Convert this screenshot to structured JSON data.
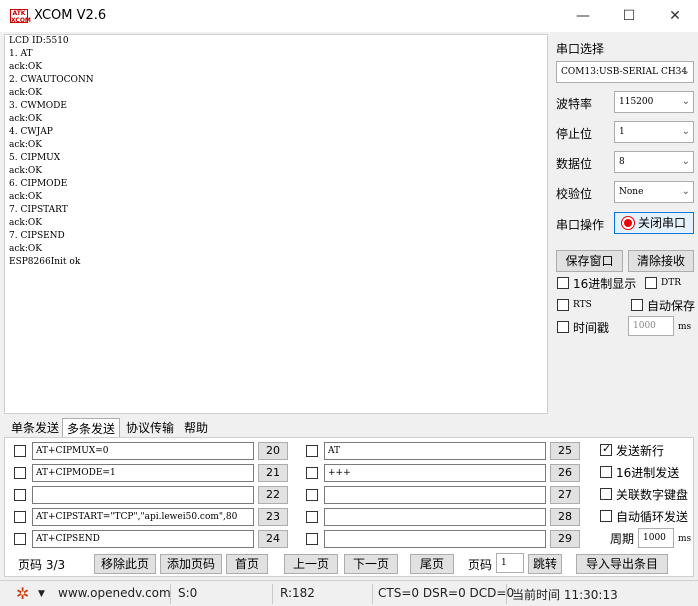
{
  "window": {
    "title": "XCOM V2.6",
    "logo_text": "ATK XCOM",
    "minimize_glyph": "—",
    "maximize_glyph": "☐",
    "close_glyph": "✕"
  },
  "receive": {
    "lines": [
      "LCD ID:5510",
      "1. AT",
      "ack:OK",
      "2. CWAUTOCONN",
      "ack:OK",
      "3. CWMODE",
      "ack:OK",
      "4. CWJAP",
      "ack:OK",
      "5. CIPMUX",
      "ack:OK",
      "6. CIPMODE",
      "ack:OK",
      "7. CIPSTART",
      "ack:OK",
      "7. CIPSEND",
      "ack:OK",
      "ESP8266Init ok"
    ]
  },
  "right_panel": {
    "port_label": "串口选择",
    "port_value": "COM13:USB-SERIAL CH34",
    "baud_label": "波特率",
    "baud_value": "115200",
    "stop_label": "停止位",
    "stop_value": "1",
    "data_label": "数据位",
    "data_value": "8",
    "parity_label": "校验位",
    "parity_value": "None",
    "serial_op_label": "串口操作",
    "close_port_label": "关闭串口",
    "save_window_label": "保存窗口",
    "clear_receive_label": "清除接收",
    "hex_display_label": "16进制显示",
    "dtr_label": "DTR",
    "rts_label": "RTS",
    "auto_save_label": "自动保存",
    "timestamp_label": "时间戳",
    "timestamp_value": "1000",
    "timestamp_unit": "ms"
  },
  "tabs": [
    {
      "label": "单条发送"
    },
    {
      "label": "多条发送"
    },
    {
      "label": "协议传输"
    },
    {
      "label": "帮助"
    }
  ],
  "multi_send": {
    "left": [
      {
        "text": "AT+CIPMUX=0",
        "num": "20"
      },
      {
        "text": "AT+CIPMODE=1",
        "num": "21"
      },
      {
        "text": "",
        "num": "22"
      },
      {
        "text": "AT+CIPSTART=\"TCP\",\"api.lewei50.com\",80",
        "num": "23"
      },
      {
        "text": "AT+CIPSEND",
        "num": "24"
      }
    ],
    "right": [
      {
        "text": "AT",
        "num": "25"
      },
      {
        "text": "+++",
        "num": "26"
      },
      {
        "text": "",
        "num": "27"
      },
      {
        "text": "",
        "num": "28"
      },
      {
        "text": "",
        "num": "29"
      }
    ],
    "send_newline_label": "发送新行",
    "hex_send_label": "16进制发送",
    "link_keyboard_label": "关联数字键盘",
    "auto_loop_label": "自动循环发送",
    "period_label": "周期",
    "period_value": "1000",
    "period_unit": "ms",
    "page_label": "页码 3/3",
    "remove_page_label": "移除此页",
    "add_page_label": "添加页码",
    "first_page_label": "首页",
    "prev_page_label": "上一页",
    "next_page_label": "下一页",
    "last_page_label": "尾页",
    "goto_page_label": "页码",
    "goto_page_value": "1",
    "jump_label": "跳转",
    "import_export_label": "导入导出条目"
  },
  "status": {
    "url": "www.openedv.com",
    "sent": "S:0",
    "received": "R:182",
    "lines": "CTS=0 DSR=0 DCD=0",
    "time": "当前时间 11:30:13"
  }
}
